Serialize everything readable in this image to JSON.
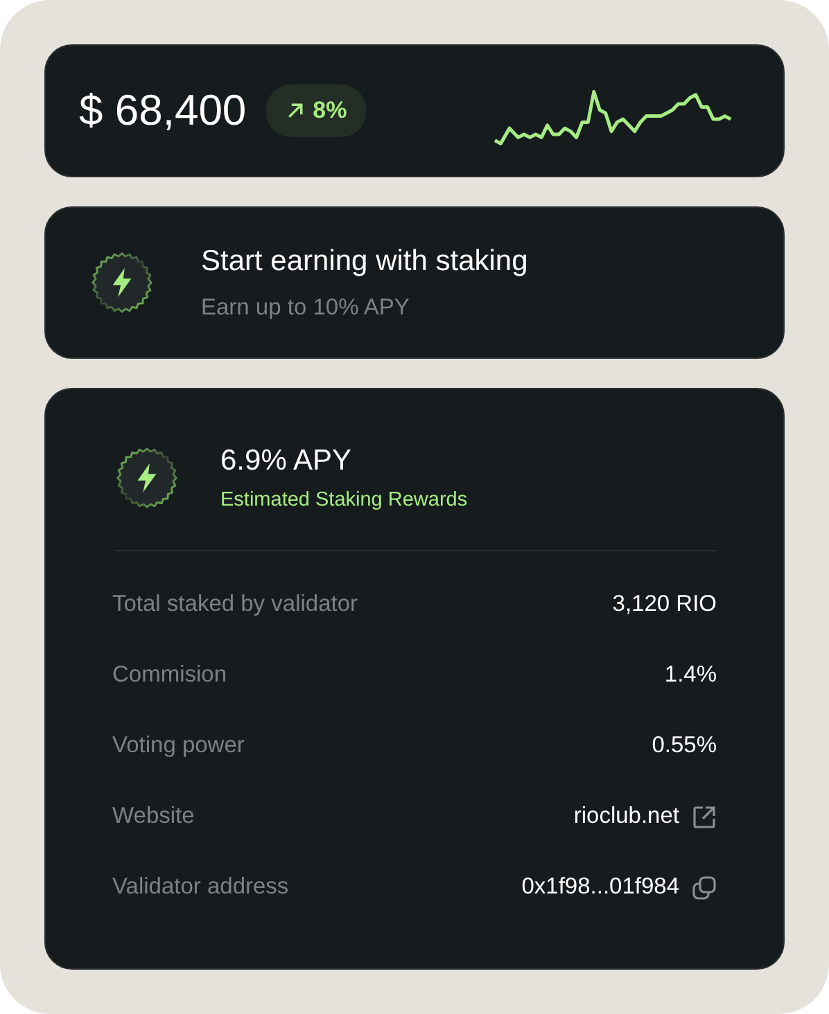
{
  "balance": {
    "amount": "$ 68,400",
    "change": "8%"
  },
  "promo": {
    "title": "Start earning with staking",
    "subtitle": "Earn up to 10% APY"
  },
  "staking": {
    "apy": "6.9% APY",
    "caption": "Estimated Staking Rewards",
    "rows": [
      {
        "label": "Total staked by validator",
        "value": "3,120 RIO",
        "kind": "text"
      },
      {
        "label": "Commision",
        "value": "1.4%",
        "kind": "text"
      },
      {
        "label": "Voting power",
        "value": "0.55%",
        "kind": "text"
      },
      {
        "label": "Website",
        "value": "rioclub.net",
        "kind": "link"
      },
      {
        "label": "Validator address",
        "value": "0x1f98...01f984",
        "kind": "copy"
      }
    ]
  }
}
